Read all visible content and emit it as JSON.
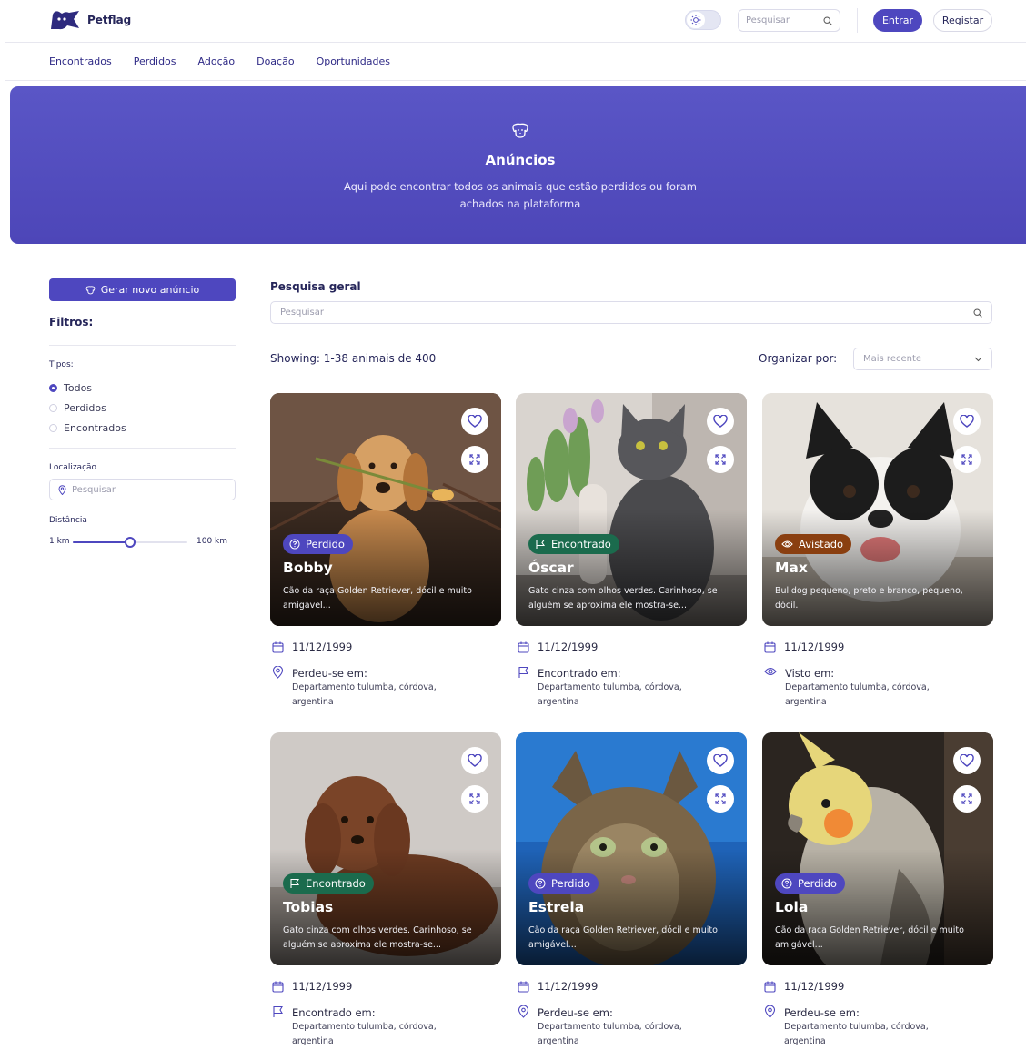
{
  "header": {
    "logo_text": "Petflag",
    "search_placeholder": "Pesquisar",
    "login_label": "Entrar",
    "register_label": "Registar"
  },
  "nav": {
    "items": [
      "Encontrados",
      "Perdidos",
      "Adoção",
      "Doação",
      "Oportunidades"
    ]
  },
  "hero": {
    "icon": "dog-face-icon",
    "title": "Anúncios",
    "subtitle": "Aqui pode encontrar todos os animais que estão perdidos ou foram achados na plataforma"
  },
  "sidebar": {
    "create_button": "Gerar novo anúncio",
    "filters_title": "Filtros:",
    "types_label": "Tipos:",
    "types": [
      {
        "label": "Todos",
        "selected": true
      },
      {
        "label": "Perdidos",
        "selected": false
      },
      {
        "label": "Encontrados",
        "selected": false
      }
    ],
    "location_label": "Localização",
    "location_placeholder": "Pesquisar",
    "distance_label": "Distância",
    "distance_min": "1 km",
    "distance_max": "100 km",
    "distance_fraction": 0.5
  },
  "main": {
    "search_label": "Pesquisa geral",
    "search_placeholder": "Pesquisar",
    "showing": "Showing: 1-38 animais de 400",
    "sort_label": "Organizar por:",
    "sort_value": "Mais recente"
  },
  "colors": {
    "accent": "#4e47bf",
    "lost": "#4e47bf",
    "found": "#1b6b4d",
    "seen": "#8a3f10"
  },
  "cards": [
    {
      "status": "Perdido",
      "status_icon": "question-circle-icon",
      "name": "Bobby",
      "description": "Cão da raça Golden Retriever, dócil e muito amigável...",
      "date": "11/12/1999",
      "location_icon": "map-pin-icon",
      "location_label": "Perdeu-se em:",
      "address": "Departamento tulumba, córdova, argentina",
      "photo": "golden-retriever-puppy"
    },
    {
      "status": "Encontrado",
      "status_icon": "flag-icon",
      "name": "Óscar",
      "description": "Gato cinza com olhos verdes. Carinhoso, se alguém se aproxima ele mostra-se...",
      "date": "11/12/1999",
      "location_icon": "flag-icon",
      "location_label": "Encontrado em:",
      "address": "Departamento tulumba, córdova, argentina",
      "photo": "grey-cat"
    },
    {
      "status": "Avistado",
      "status_icon": "eye-icon",
      "name": "Max",
      "description": "Bulldog pequeno, preto e branco, pequeno, dócil.",
      "date": "11/12/1999",
      "location_icon": "eye-icon",
      "location_label": "Visto em:",
      "address": "Departamento tulumba, córdova, argentina",
      "photo": "french-bulldog"
    },
    {
      "status": "Encontrado",
      "status_icon": "flag-icon",
      "name": "Tobias",
      "description": "Gato cinza com olhos verdes. Carinhoso, se alguém se aproxima ele mostra-se...",
      "date": "11/12/1999",
      "location_icon": "flag-icon",
      "location_label": "Encontrado em:",
      "address": "Departamento tulumba, córdova, argentina",
      "photo": "brown-poodle"
    },
    {
      "status": "Perdido",
      "status_icon": "question-circle-icon",
      "name": "Estrela",
      "description": "Cão da raça Golden Retriever, dócil e muito amigável...",
      "date": "11/12/1999",
      "location_icon": "map-pin-icon",
      "location_label": "Perdeu-se em:",
      "address": "Departamento tulumba, córdova, argentina",
      "photo": "tabby-cat"
    },
    {
      "status": "Perdido",
      "status_icon": "question-circle-icon",
      "name": "Lola",
      "description": "Cão da raça Golden Retriever, dócil e muito amigável...",
      "date": "11/12/1999",
      "location_icon": "map-pin-icon",
      "location_label": "Perdeu-se em:",
      "address": "Departamento tulumba, córdova, argentina",
      "photo": "cockatiel"
    }
  ]
}
